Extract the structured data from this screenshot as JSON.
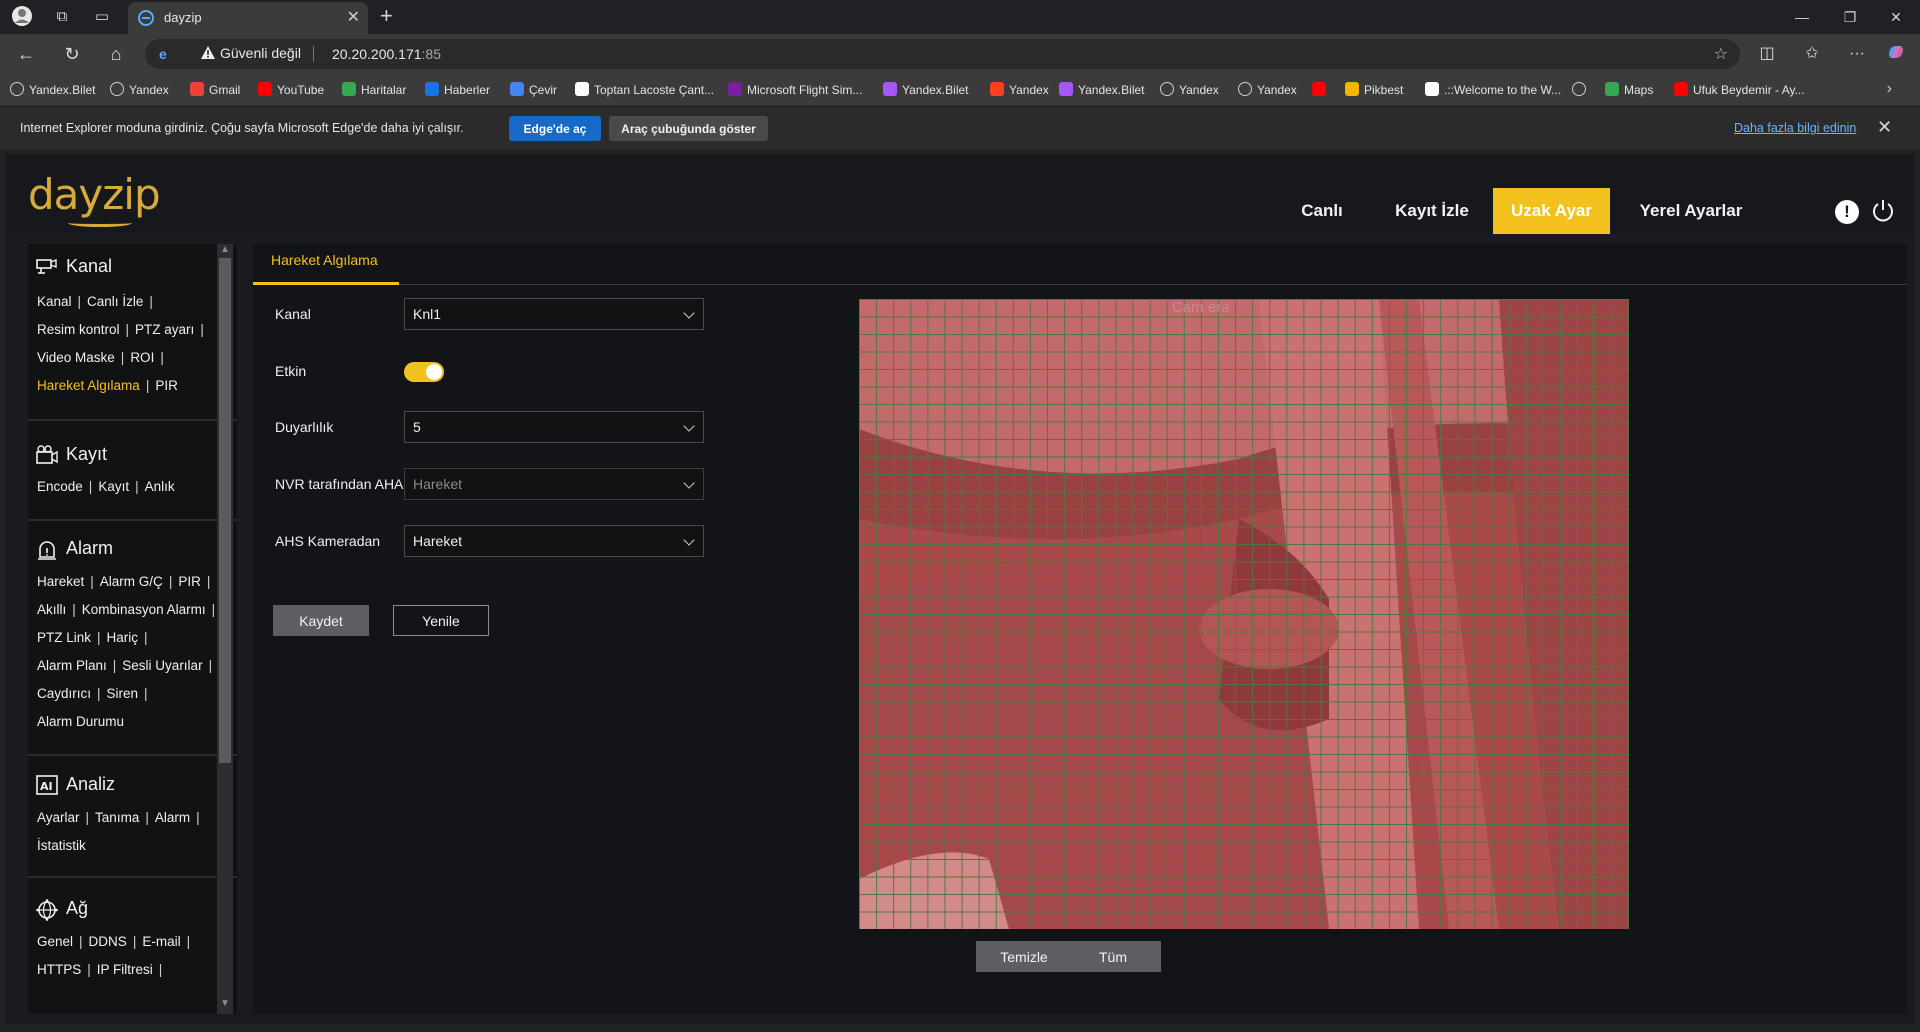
{
  "browser": {
    "tab_title": "dayzip",
    "address": {
      "security": "Güvenli değil",
      "host": "20.20.200.171",
      "port": ":85"
    },
    "bookmarks": [
      {
        "label": "Yandex.Bilet",
        "icon": "globe-icon",
        "color": "#cfcfcf"
      },
      {
        "label": "Yandex",
        "icon": "globe-icon",
        "color": "#cfcfcf"
      },
      {
        "label": "Gmail",
        "icon": "gmail-icon",
        "color": "#ea4335"
      },
      {
        "label": "YouTube",
        "icon": "youtube-icon",
        "color": "#ff0000"
      },
      {
        "label": "Haritalar",
        "icon": "maps-pin-icon",
        "color": "#34a853"
      },
      {
        "label": "Haberler",
        "icon": "news-icon",
        "color": "#1a73e8"
      },
      {
        "label": "Çevir",
        "icon": "translate-icon",
        "color": "#4285f4"
      },
      {
        "label": "Toptan Lacoste Çant...",
        "icon": "t-icon",
        "color": "#ffffff"
      },
      {
        "label": "Microsoft Flight Sim...",
        "icon": "flight-sim-icon",
        "color": "#7a1fa2"
      },
      {
        "label": "Yandex.Bilet",
        "icon": "yandex-bilet-icon",
        "color": "#a855f7"
      },
      {
        "label": "Yandex",
        "icon": "yandex-icon",
        "color": "#fc3f1d"
      },
      {
        "label": "Yandex.Bilet",
        "icon": "yandex-bilet-icon",
        "color": "#a855f7"
      },
      {
        "label": "Yandex",
        "icon": "globe-icon",
        "color": "#cfcfcf"
      },
      {
        "label": "Yandex",
        "icon": "globe-icon",
        "color": "#cfcfcf"
      },
      {
        "label": "",
        "icon": "youtube-icon",
        "color": "#ff0000"
      },
      {
        "label": "Pikbest",
        "icon": "pikbest-icon",
        "color": "#f5b400"
      },
      {
        "label": ".::Welcome to the W...",
        "icon": "z-icon",
        "color": "#ffffff"
      },
      {
        "label": "",
        "icon": "globe-icon",
        "color": "#cfcfcf"
      },
      {
        "label": "Maps",
        "icon": "maps-pin-icon",
        "color": "#34a853"
      },
      {
        "label": "Ufuk Beydemir - Ay...",
        "icon": "youtube-icon",
        "color": "#ff0000"
      }
    ],
    "ie_bar": {
      "message": "Internet Explorer moduna girdiniz. Çoğu sayfa Microsoft Edge'de daha iyi çalışır.",
      "open_in_edge": "Edge'de aç",
      "show_in_toolbar": "Araç çubuğunda göster",
      "learn_more": "Daha fazla bilgi edinin"
    }
  },
  "app": {
    "logo": "dayzip",
    "accent": "#f3c11d",
    "top_nav": [
      {
        "label": "Canlı",
        "active": false
      },
      {
        "label": "Kayıt İzle",
        "active": false
      },
      {
        "label": "Uzak Ayar",
        "active": true
      },
      {
        "label": "Yerel Ayarlar",
        "active": false
      }
    ],
    "info_glyph": "!",
    "sidebar": {
      "kanal": {
        "title": "Kanal",
        "rows": [
          [
            "Kanal",
            "Canlı İzle"
          ],
          [
            "Resim kontrol",
            "PTZ ayarı"
          ],
          [
            "Video Maske",
            "ROI"
          ],
          [
            "Hareket Algılama",
            "PIR"
          ]
        ]
      },
      "kayit": {
        "title": "Kayıt",
        "rows": [
          [
            "Encode",
            "Kayıt",
            "Anlık"
          ]
        ]
      },
      "alarm": {
        "title": "Alarm",
        "rows": [
          [
            "Hareket",
            "Alarm G/Ç",
            "PIR"
          ],
          [
            "Akıllı",
            "Kombinasyon Alarmı"
          ],
          [
            "PTZ Link",
            "Hariç"
          ],
          [
            "Alarm Planı",
            "Sesli Uyarılar"
          ],
          [
            "Caydırıcı",
            "Siren"
          ],
          [
            "Alarm Durumu"
          ]
        ]
      },
      "analiz": {
        "title": "Analiz",
        "rows": [
          [
            "Ayarlar",
            "Tanıma",
            "Alarm"
          ],
          [
            "İstatistik"
          ]
        ]
      },
      "ag": {
        "title": "Ağ",
        "rows": [
          [
            "Genel",
            "DDNS",
            "E-mail"
          ],
          [
            "HTTPS",
            "IP Filtresi"
          ]
        ]
      }
    },
    "main": {
      "tab": "Hareket Algılama",
      "fields": {
        "kanal": {
          "label": "Kanal",
          "value": "Knl1"
        },
        "etkin": {
          "label": "Etkin",
          "value": true
        },
        "duyarlilik": {
          "label": "Duyarlılık",
          "value": "5"
        },
        "nvr": {
          "label": "NVR tarafından AHA",
          "value": "Hareket"
        },
        "ahs": {
          "label": "AHS Kameradan",
          "value": "Hareket"
        }
      },
      "save": "Kaydet",
      "refresh": "Yenile",
      "camera_label": "Cam era",
      "clear": "Temizle",
      "all": "Tüm"
    }
  }
}
